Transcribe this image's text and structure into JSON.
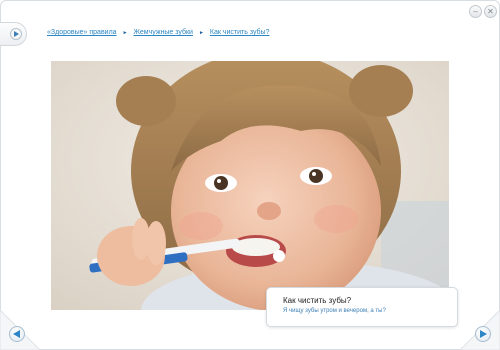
{
  "breadcrumb": {
    "items": [
      {
        "label": "«Здоровые» правила"
      },
      {
        "label": "Жемчужные зубки"
      },
      {
        "label": "Как чистить зубы?"
      }
    ]
  },
  "photo": {
    "subject": "girl-brushing-teeth"
  },
  "caption": {
    "title": "Как чистить зубы?",
    "text": "Я чищу зубы утром и вечером, а ты?"
  },
  "icons": {
    "minimize": "minimize-icon",
    "close": "close-icon",
    "prev": "arrow-left-icon",
    "next": "arrow-right-icon",
    "side_toggle": "play-icon"
  },
  "colors": {
    "accent": "#2f86c6",
    "link": "#2a86c4",
    "border": "#d5dadf"
  }
}
